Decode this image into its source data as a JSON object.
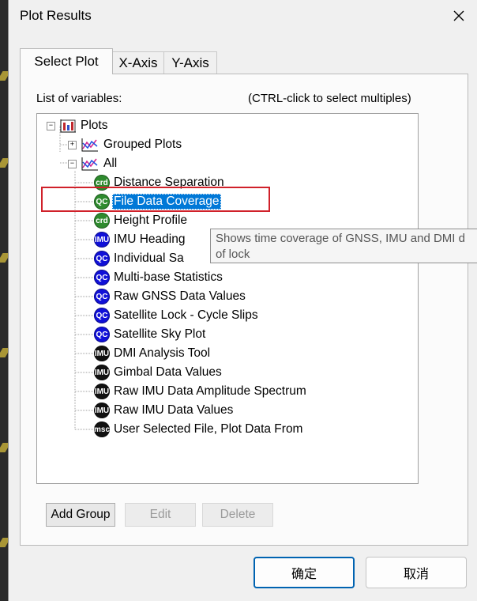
{
  "window": {
    "title": "Plot Results"
  },
  "tabs": [
    {
      "label": "Select Plot"
    },
    {
      "label": "X-Axis"
    },
    {
      "label": "Y-Axis"
    }
  ],
  "panel": {
    "list_label": "List of variables:",
    "hint": "(CTRL-click to select multiples)"
  },
  "tree": {
    "root": "Plots",
    "grouped": "Grouped Plots",
    "all": "All",
    "items": [
      {
        "label": "Distance Separation",
        "badge": "crd",
        "color": "#2e8b2e"
      },
      {
        "label": "File Data Coverage",
        "badge": "QC",
        "color": "#2e8b2e"
      },
      {
        "label": "Height Profile",
        "badge": "crd",
        "color": "#2e8b2e"
      },
      {
        "label": "IMU Heading",
        "badge": "IMU",
        "color": "#1010d8"
      },
      {
        "label": "Individual Sa",
        "badge": "QC",
        "color": "#1010d8"
      },
      {
        "label": "Multi-base Statistics",
        "badge": "QC",
        "color": "#1010d8"
      },
      {
        "label": "Raw GNSS Data Values",
        "badge": "QC",
        "color": "#1010d8"
      },
      {
        "label": "Satellite Lock - Cycle Slips",
        "badge": "QC",
        "color": "#1010d8"
      },
      {
        "label": "Satellite Sky Plot",
        "badge": "QC",
        "color": "#1010d8"
      },
      {
        "label": "DMI Analysis Tool",
        "badge": "IMU",
        "color": "#111111"
      },
      {
        "label": "Gimbal Data Values",
        "badge": "IMU",
        "color": "#111111"
      },
      {
        "label": "Raw IMU Data Amplitude Spectrum",
        "badge": "IMU",
        "color": "#111111"
      },
      {
        "label": "Raw IMU Data Values",
        "badge": "IMU",
        "color": "#111111"
      },
      {
        "label": "User Selected File, Plot Data From",
        "badge": "msc",
        "color": "#111111"
      }
    ]
  },
  "tooltip": {
    "line1": "Shows time coverage of GNSS, IMU and DMI d",
    "line2": "of lock"
  },
  "group_buttons": {
    "add": "Add Group",
    "edit": "Edit",
    "delete": "Delete"
  },
  "footer": {
    "ok": "确定",
    "cancel": "取消"
  },
  "accent": "#0078d7",
  "highlight_color": "#d0212a"
}
